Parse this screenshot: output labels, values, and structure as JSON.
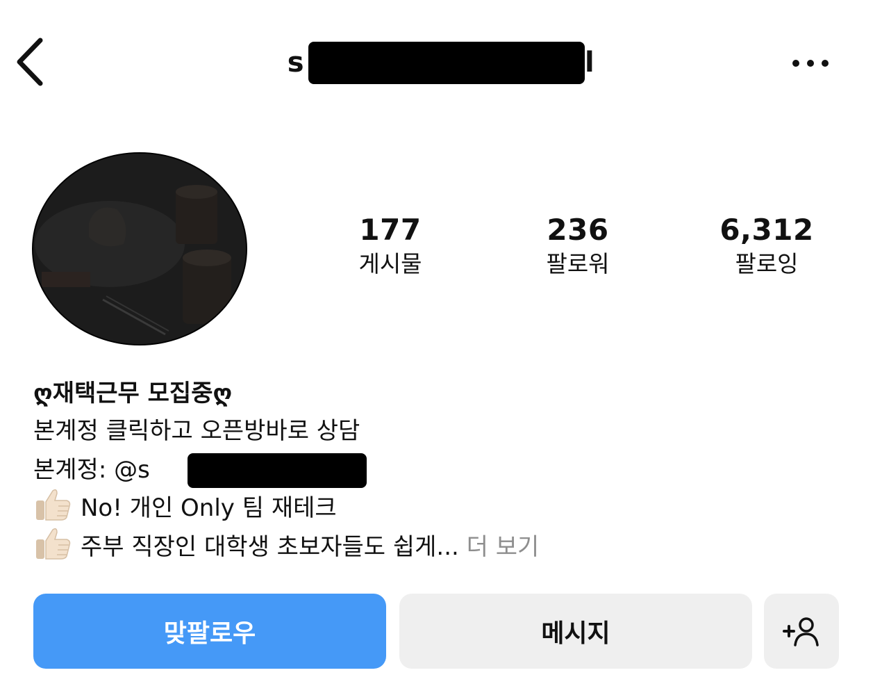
{
  "header": {
    "username_visible_start": "s",
    "username_visible_end": "l",
    "back_icon": "chevron-left-icon",
    "more_icon": "more-horizontal-icon"
  },
  "stats": [
    {
      "value": "177",
      "label": "게시물"
    },
    {
      "value": "236",
      "label": "팔로워"
    },
    {
      "value": "6,312",
      "label": "팔로잉"
    }
  ],
  "bio": {
    "name": "ღ재택근무 모집중ღ",
    "line1": "본계정 클릭하고 오픈방바로 상담",
    "line2_prefix": "본계정: @s",
    "line3": "No! 개인 Only 팀 재테크",
    "line4": "주부 직장인 대학생 초보자들도 쉽게...",
    "more_label": "더 보기",
    "thumb_icon": "thumbs-up-icon"
  },
  "buttons": {
    "follow_back": "맞팔로우",
    "message": "메시지",
    "add_person_icon": "add-person-icon"
  },
  "colors": {
    "primary_button": "#4599f7",
    "secondary_button": "#efefef",
    "muted_text": "#8e8e8e"
  }
}
